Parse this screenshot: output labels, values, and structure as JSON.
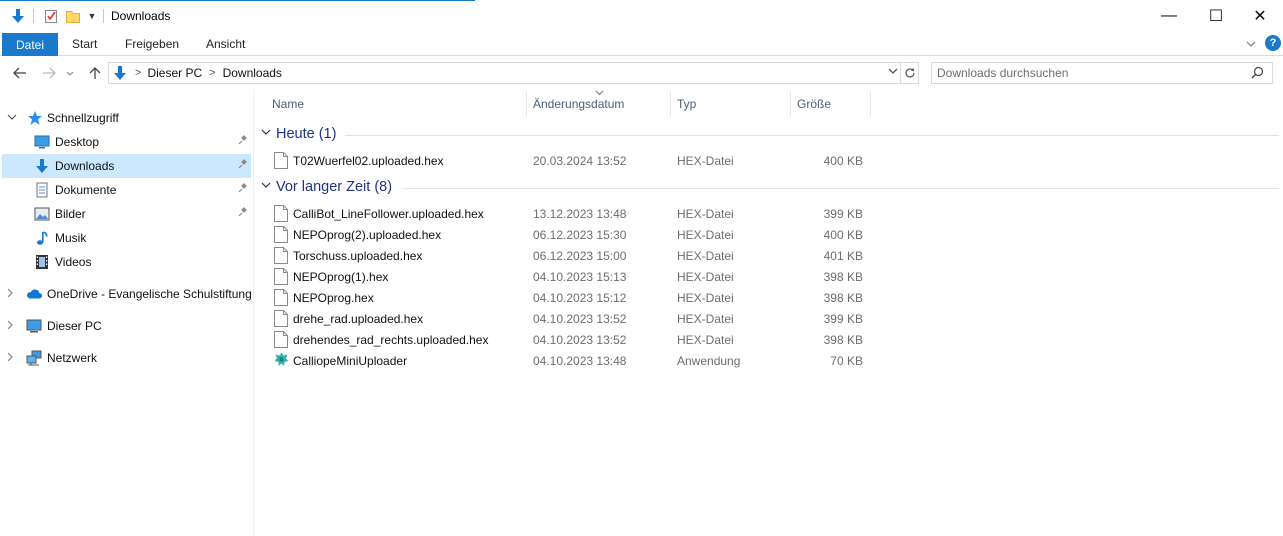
{
  "window": {
    "title": "Downloads",
    "minimize_symbol": "—",
    "maximize_symbol": "☐",
    "close_symbol": "✕"
  },
  "ribbon": {
    "tabs": [
      "Datei",
      "Start",
      "Freigeben",
      "Ansicht"
    ],
    "help_label": "?"
  },
  "address": {
    "breadcrumb": [
      "Dieser PC",
      "Downloads"
    ]
  },
  "search": {
    "placeholder": "Downloads durchsuchen"
  },
  "sidebar": {
    "items": [
      {
        "label": "Schnellzugriff",
        "icon": "star-icon"
      },
      {
        "label": "Desktop",
        "icon": "desktop-icon",
        "pinned": true
      },
      {
        "label": "Downloads",
        "icon": "download-arrow-icon",
        "pinned": true,
        "selected": true
      },
      {
        "label": "Dokumente",
        "icon": "document-icon",
        "pinned": true
      },
      {
        "label": "Bilder",
        "icon": "pictures-icon",
        "pinned": true
      },
      {
        "label": "Musik",
        "icon": "music-note-icon"
      },
      {
        "label": "Videos",
        "icon": "film-icon"
      },
      {
        "label": "OneDrive - Evangelische Schulstiftung",
        "icon": "cloud-icon"
      },
      {
        "label": "Dieser PC",
        "icon": "computer-icon"
      },
      {
        "label": "Netzwerk",
        "icon": "network-icon"
      }
    ]
  },
  "columns": {
    "name": "Name",
    "date": "Änderungsdatum",
    "type": "Typ",
    "size": "Größe"
  },
  "groups": [
    {
      "title": "Heute (1)",
      "files": [
        {
          "name": "T02Wuerfel02.uploaded.hex",
          "date": "20.03.2024 13:52",
          "type": "HEX-Datei",
          "size": "400 KB",
          "icon": "file-icon"
        }
      ]
    },
    {
      "title": "Vor langer Zeit (8)",
      "files": [
        {
          "name": "CalliBot_LineFollower.uploaded.hex",
          "date": "13.12.2023 13:48",
          "type": "HEX-Datei",
          "size": "399 KB",
          "icon": "file-icon"
        },
        {
          "name": "NEPOprog(2).uploaded.hex",
          "date": "06.12.2023 15:30",
          "type": "HEX-Datei",
          "size": "400 KB",
          "icon": "file-icon"
        },
        {
          "name": "Torschuss.uploaded.hex",
          "date": "06.12.2023 15:00",
          "type": "HEX-Datei",
          "size": "401 KB",
          "icon": "file-icon"
        },
        {
          "name": "NEPOprog(1).hex",
          "date": "04.10.2023 15:13",
          "type": "HEX-Datei",
          "size": "398 KB",
          "icon": "file-icon"
        },
        {
          "name": "NEPOprog.hex",
          "date": "04.10.2023 15:12",
          "type": "HEX-Datei",
          "size": "398 KB",
          "icon": "file-icon"
        },
        {
          "name": "drehe_rad.uploaded.hex",
          "date": "04.10.2023 13:52",
          "type": "HEX-Datei",
          "size": "399 KB",
          "icon": "file-icon"
        },
        {
          "name": "drehendes_rad_rechts.uploaded.hex",
          "date": "04.10.2023 13:52",
          "type": "HEX-Datei",
          "size": "398 KB",
          "icon": "file-icon"
        },
        {
          "name": "CalliopeMiniUploader",
          "date": "04.10.2023 13:48",
          "type": "Anwendung",
          "size": "70 KB",
          "icon": "app-icon"
        }
      ]
    }
  ],
  "colors": {
    "accent": "#1979ca",
    "selection": "#cce8ff",
    "group_title": "#1e3287",
    "column_header": "#4c607a"
  }
}
